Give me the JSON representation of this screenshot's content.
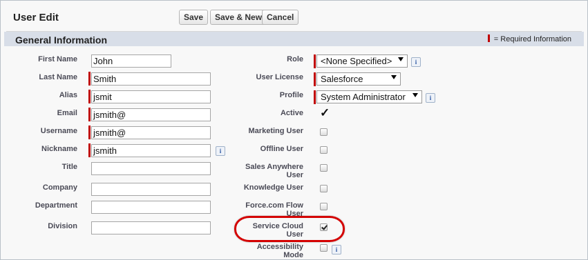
{
  "header": {
    "title": "User Edit",
    "buttons": {
      "save": "Save",
      "save_new": "Save & New",
      "cancel": "Cancel"
    }
  },
  "section": {
    "title": "General Information",
    "required_legend": "= Required Information",
    "required_color": "#c00000",
    "highlight_color": "#d40000"
  },
  "left_fields": {
    "first_name": {
      "label": "First Name",
      "value": "John",
      "required": false
    },
    "last_name": {
      "label": "Last Name",
      "value": "Smith",
      "required": true
    },
    "alias": {
      "label": "Alias",
      "value": "jsmit",
      "required": true
    },
    "email": {
      "label": "Email",
      "value": "jsmith@",
      "required": true
    },
    "username": {
      "label": "Username",
      "value": "jsmith@",
      "required": true
    },
    "nickname": {
      "label": "Nickname",
      "value": "jsmith",
      "required": true,
      "info_icon": "info-icon"
    },
    "title": {
      "label": "Title",
      "value": ""
    },
    "company": {
      "label": "Company",
      "value": ""
    },
    "department": {
      "label": "Department",
      "value": ""
    },
    "division": {
      "label": "Division",
      "value": ""
    }
  },
  "right_fields": {
    "role": {
      "label": "Role",
      "value": "<None Specified>",
      "info_icon": "info-icon"
    },
    "user_license": {
      "label": "User License",
      "value": "Salesforce"
    },
    "profile": {
      "label": "Profile",
      "value": "System Administrator",
      "info_icon": "info-icon"
    },
    "active": {
      "label": "Active",
      "checked": true
    },
    "marketing_user": {
      "label": "Marketing User",
      "checked": false
    },
    "offline_user": {
      "label": "Offline User",
      "checked": false
    },
    "sales_anywhere_user": {
      "label_line1": "Sales Anywhere",
      "label_line2": "User",
      "checked": false
    },
    "knowledge_user": {
      "label": "Knowledge User",
      "checked": false
    },
    "force_flow_user": {
      "label_line1": "Force.com Flow",
      "label_line2": "User",
      "checked": false
    },
    "service_cloud_user": {
      "label_line1": "Service Cloud",
      "label_line2": "User",
      "checked": true,
      "highlighted": true
    },
    "accessibility_mode": {
      "label_line1": "Accessibility",
      "label_line2": "Mode",
      "checked": false,
      "info_icon": "info-icon"
    }
  },
  "icons": {
    "active_check": "✓",
    "info": "i"
  }
}
